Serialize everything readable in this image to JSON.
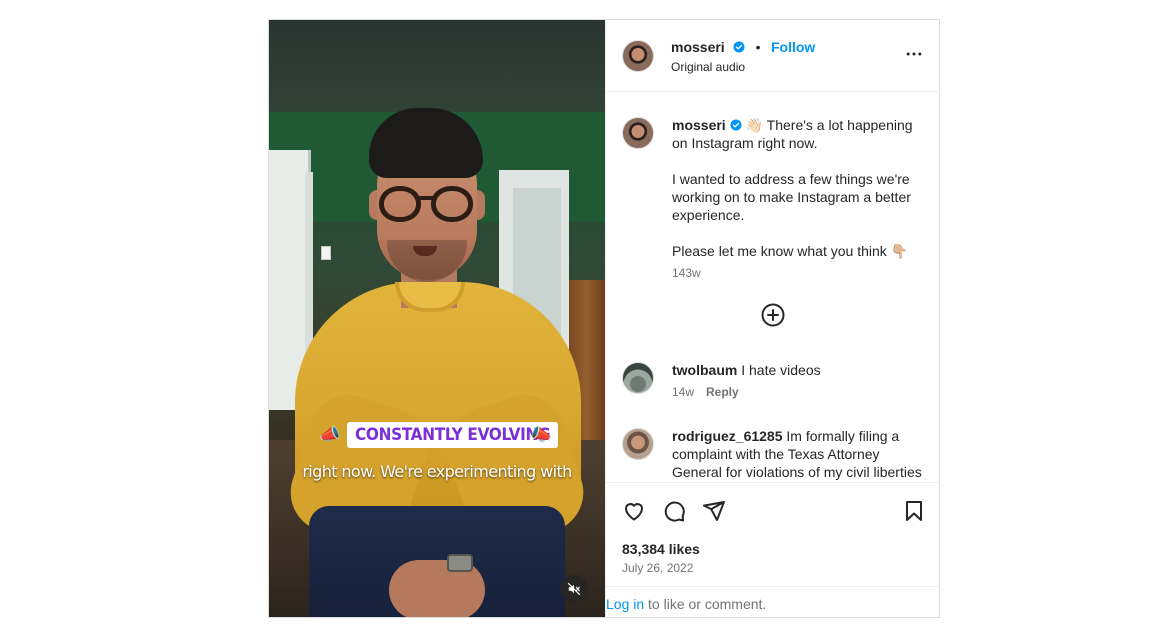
{
  "header": {
    "username": "mosseri",
    "follow_label": "Follow",
    "audio_label": "Original audio",
    "dot": "•"
  },
  "video": {
    "caption_tag": "CONSTANTLY EVOLVING",
    "subtitle": "right now. We're experimenting with",
    "mute_icon": "speaker-muted-icon"
  },
  "caption": {
    "username": "mosseri",
    "wave_emoji": "👋🏻",
    "line1": "There's a lot happening on Instagram right now.",
    "line2": "I wanted to address a few things we're working on to make Instagram a better experience.",
    "line3": "Please let me know what you think",
    "point_emoji": "👇🏼",
    "time": "143w"
  },
  "comments": [
    {
      "username": "twolbaum",
      "text": "I hate videos",
      "time": "14w",
      "reply_label": "Reply"
    },
    {
      "username": "rodriguez_61285",
      "text": "Im formally filing a complaint with the Texas Attorney General for violations of my civil liberties"
    }
  ],
  "actions": {
    "likes": "83,384 likes",
    "date": "July 26, 2022"
  },
  "login": {
    "link": "Log in",
    "rest": " to like or comment."
  },
  "colors": {
    "accent": "#0095f6",
    "caption_purple": "#7b2fd6",
    "verified": "#0095f6"
  }
}
